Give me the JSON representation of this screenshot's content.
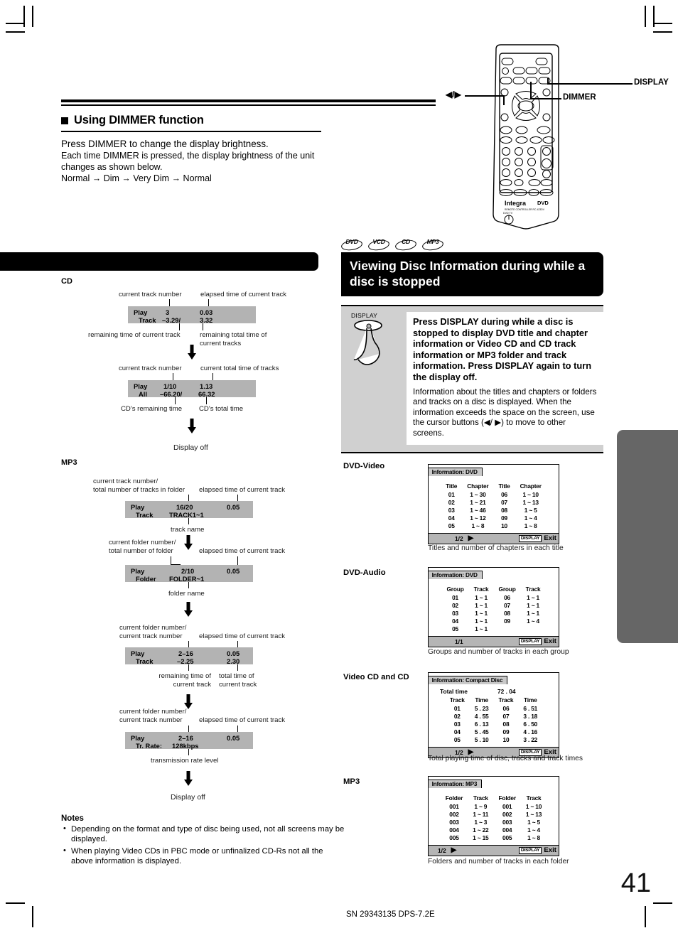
{
  "page": {
    "number": "41",
    "footer": "SN 29343135 DPS-7.2E"
  },
  "remote": {
    "callouts": [
      {
        "label": "DISPLAY"
      },
      {
        "label": "DIMMER"
      },
      {
        "label": "◀/▶"
      }
    ],
    "brand": "Integra",
    "logo": "DVD"
  },
  "dimmer_section": {
    "bullet_icon": "filled-square-icon",
    "heading": "Using DIMMER function",
    "lines": [
      "Press DIMMER to change the display brightness.",
      "Each time DIMMER is pressed, the display brightness of the unit",
      "changes as shown below.",
      "Normal → Dim → Very Dim → Normal"
    ]
  },
  "cd_flow": {
    "kind": "CD",
    "steps": [
      {
        "top_captions": [
          "current track number",
          "elapsed time of current track"
        ],
        "vfd": {
          "label1": "Play",
          "label2": "Track",
          "c1_top": "3",
          "c1_bot": "–3.29/",
          "c2_top": "0.03",
          "c2_bot": "3.32"
        },
        "bottom_captions": [
          "remaining time of current track",
          "remaining total time of\ncurrent tracks"
        ]
      },
      {
        "top_captions": [
          "current track number",
          "current total time of tracks"
        ],
        "vfd": {
          "label1": "Play",
          "label2": "All",
          "c1_top": "1/10",
          "c1_bot": "–66.20/",
          "c2_top": "1.13",
          "c2_bot": "66.32"
        },
        "bottom_captions": [
          "CD's remaining time",
          "CD's total time"
        ]
      }
    ],
    "end": "Display off"
  },
  "mp3_flow": {
    "kind": "MP3",
    "steps": [
      {
        "top_captions": [
          "current track number/\ntotal number of tracks in folder",
          "elapsed time of current track"
        ],
        "vfd": {
          "label1": "Play",
          "label2": "Track",
          "c1_top": "16/20",
          "c1_bot": "TRACK1~1",
          "c2_top": "0.05",
          "c2_bot": ""
        },
        "bottom_captions": [
          "track name"
        ]
      },
      {
        "top_captions": [
          "current folder number/\ntotal number of folder",
          "elapsed time of current track"
        ],
        "vfd": {
          "label1": "Play",
          "label2": "Folder",
          "c1_top": "2/10",
          "c1_bot": "FOLDER~1",
          "c2_top": "0.05",
          "c2_bot": ""
        },
        "bottom_captions": [
          "folder name"
        ]
      },
      {
        "top_captions": [
          "current folder number/\ncurrent track number",
          "elapsed time of current track"
        ],
        "vfd": {
          "label1": "Play",
          "label2": "Track",
          "c1_top": "2–16",
          "c1_bot": "–2.25",
          "c2_top": "0.05",
          "c2_bot": "2.30"
        },
        "bottom_captions": [
          "remaining time of\ncurrent track",
          "total time of\ncurrent track"
        ]
      },
      {
        "top_captions": [
          "current folder number/\ncurrent track number",
          "elapsed time of current track"
        ],
        "vfd": {
          "label1": "Play",
          "label2": "Tr. Rate:",
          "c1_top": "2–16",
          "c1_bot": "128kbps",
          "c2_top": "0.05",
          "c2_bot": ""
        },
        "bottom_captions": [
          "transmission rate level"
        ]
      }
    ],
    "end": "Display off"
  },
  "notes": {
    "heading": "Notes",
    "items": [
      "Depending on the format and type of disc being used, not all screens may be displayed.",
      "When playing Video CDs in PBC mode or unfinalized CD-Rs not all the above information is displayed."
    ]
  },
  "disc_badges": [
    "DVD",
    "VCD",
    "CD",
    "MP3"
  ],
  "section": {
    "title": "Viewing Disc Information during while a disc is stopped",
    "button_label": "DISPLAY",
    "button_icon": "hand-press-icon",
    "bold_paragraph": "Press DISPLAY during while a disc is stopped to display DVD title and chapter information or Video CD and CD track information or MP3 folder and track information. Press DISPLAY again to turn the display off.",
    "paragraph": "Information about the titles and chapters or folders and tracks on a disc is displayed. When the information exceeds the space on the screen, use the cursor buttons (◀/ ▶) to move to other screens."
  },
  "osd_panels": [
    {
      "kind": "DVD-Video",
      "tab": "Information: DVD",
      "headers": [
        "Title",
        "Chapter",
        "Title",
        "Chapter"
      ],
      "rows": [
        [
          "01",
          "1 ~ 30",
          "06",
          "1 ~ 10"
        ],
        [
          "02",
          "1 ~ 21",
          "07",
          "1 ~ 13"
        ],
        [
          "03",
          "1 ~ 46",
          "08",
          "1 ~ 5"
        ],
        [
          "04",
          "1 ~ 12",
          "09",
          "1 ~ 4"
        ],
        [
          "05",
          "1 ~ 8",
          "10",
          "1 ~ 8"
        ]
      ],
      "page": "1/2",
      "has_next_arrow": true,
      "foot_display": "DISPLAY",
      "foot_exit": "Exit",
      "caption": "Titles and number of chapters in each title"
    },
    {
      "kind": "DVD-Audio",
      "tab": "Information: DVD",
      "headers": [
        "Group",
        "Track",
        "Group",
        "Track"
      ],
      "rows": [
        [
          "01",
          "1 ~ 1",
          "06",
          "1 ~ 1"
        ],
        [
          "02",
          "1 ~ 1",
          "07",
          "1 ~ 1"
        ],
        [
          "03",
          "1 ~ 1",
          "08",
          "1 ~ 1"
        ],
        [
          "04",
          "1 ~ 1",
          "09",
          "1 ~ 4"
        ],
        [
          "05",
          "1 ~ 1",
          "",
          ""
        ]
      ],
      "page": "1/1",
      "has_next_arrow": false,
      "foot_display": "DISPLAY",
      "foot_exit": "Exit",
      "caption": "Groups and number of tracks in each group"
    },
    {
      "kind": "Video CD and CD",
      "tab": "Information: Compact Disc",
      "total_label": "Total time",
      "total_value": "72 . 04",
      "headers": [
        "Track",
        "Time",
        "Track",
        "Time"
      ],
      "rows": [
        [
          "01",
          "5 . 23",
          "06",
          "6 . 51"
        ],
        [
          "02",
          "4 . 55",
          "07",
          "3 . 18"
        ],
        [
          "03",
          "6 . 13",
          "08",
          "6 . 50"
        ],
        [
          "04",
          "5 . 45",
          "09",
          "4 . 16"
        ],
        [
          "05",
          "5 . 10",
          "10",
          "3 . 22"
        ]
      ],
      "page": "1/2",
      "has_next_arrow": true,
      "foot_display": "DISPLAY",
      "foot_exit": "Exit",
      "caption": "Total playing time of disc, tracks and track times"
    },
    {
      "kind": "MP3",
      "tab": "Information: MP3",
      "headers": [
        "Folder",
        "Track",
        "Folder",
        "Track"
      ],
      "rows": [
        [
          "001",
          "1 ~ 9",
          "001",
          "1 ~ 10"
        ],
        [
          "002",
          "1 ~ 11",
          "002",
          "1 ~ 13"
        ],
        [
          "003",
          "1 ~ 3",
          "003",
          "1 ~ 5"
        ],
        [
          "004",
          "1 ~ 22",
          "004",
          "1 ~ 4"
        ],
        [
          "005",
          "1 ~ 15",
          "005",
          "1 ~ 8"
        ]
      ],
      "page": "1/2",
      "has_next_arrow": true,
      "foot_display": "DISPLAY",
      "foot_exit": "Exit",
      "caption": "Folders and number of tracks in each folder"
    }
  ]
}
